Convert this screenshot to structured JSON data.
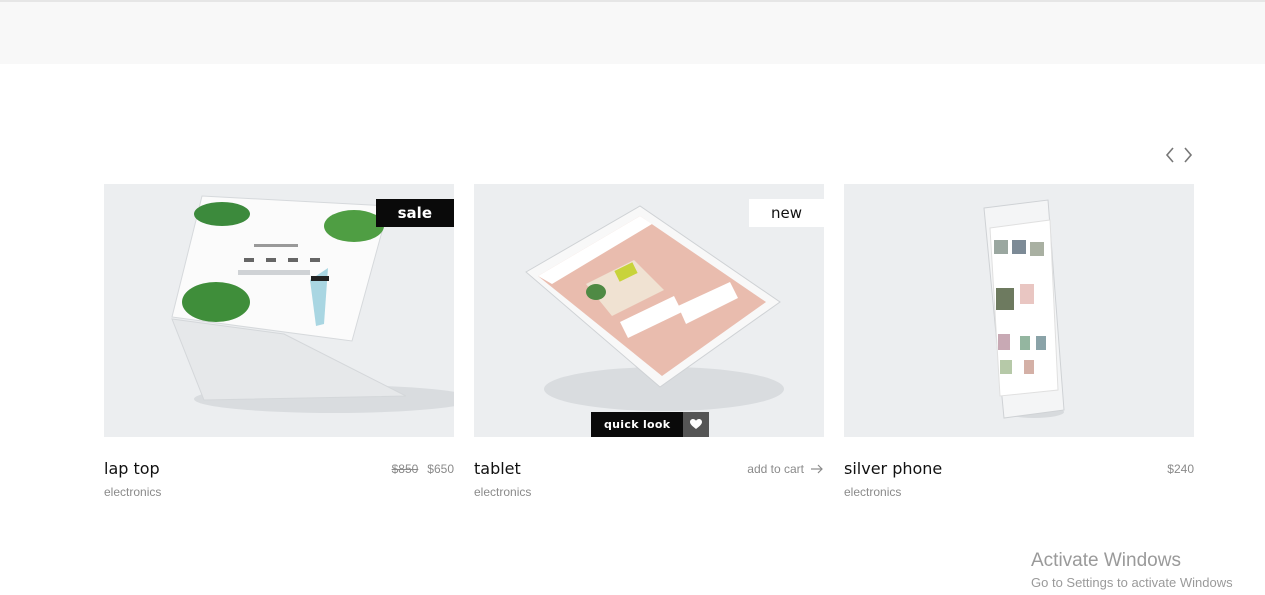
{
  "products": [
    {
      "name": "lap top",
      "category": "electronics",
      "badge": "sale",
      "old_price": "$850",
      "price": "$650",
      "image": "laptop-mockup"
    },
    {
      "name": "tablet",
      "category": "electronics",
      "badge": "new",
      "action": "add to cart",
      "image": "tablet-mockup"
    },
    {
      "name": "silver phone",
      "category": "electronics",
      "price": "$240",
      "image": "phone-mockup"
    }
  ],
  "quick_look": {
    "label": "quick look",
    "icon": "heart-icon"
  },
  "carousel": {
    "prev_icon": "chevron-left-icon",
    "next_icon": "chevron-right-icon"
  },
  "watermark": {
    "title": "Activate Windows",
    "subtitle": "Go to Settings to activate Windows"
  },
  "colors": {
    "badge_dark": "#0a0a0a",
    "image_bg": "#eceef0",
    "muted_text": "#8a8a8a"
  }
}
